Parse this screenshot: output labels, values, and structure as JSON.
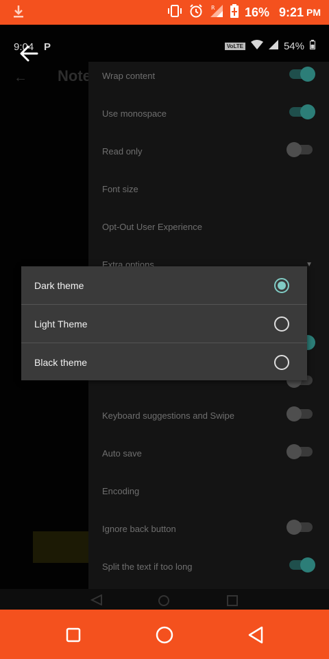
{
  "outer_status": {
    "battery": "16%",
    "time": "9:21",
    "ampm": "PM"
  },
  "inner_status": {
    "time": "9:04",
    "p_icon": "P",
    "volte": "VoLTE",
    "battery": "54%"
  },
  "underlying": {
    "title": "Note"
  },
  "settings": [
    {
      "label": "Wrap content",
      "control": "toggle",
      "on": true
    },
    {
      "label": "Use monospace",
      "control": "toggle",
      "on": true
    },
    {
      "label": "Read only",
      "control": "toggle",
      "on": false
    },
    {
      "label": "Font size",
      "control": "none"
    },
    {
      "label": "Opt-Out User Experience",
      "control": "none"
    },
    {
      "label": "Extra options",
      "control": "chevron"
    },
    {
      "label": "Keyboard suggestions and Swipe",
      "control": "toggle",
      "on": false
    },
    {
      "label": "Auto save",
      "control": "toggle",
      "on": false
    },
    {
      "label": "Encoding",
      "control": "none"
    },
    {
      "label": "Ignore back button",
      "control": "toggle",
      "on": false
    },
    {
      "label": "Split the text if too long",
      "control": "toggle",
      "on": true
    }
  ],
  "theme_dialog": {
    "options": [
      {
        "label": "Dark theme",
        "selected": true
      },
      {
        "label": "Light Theme",
        "selected": false
      },
      {
        "label": "Black theme",
        "selected": false
      }
    ]
  },
  "colors": {
    "accent": "#80cbc4",
    "system_bar": "#f4511e"
  }
}
